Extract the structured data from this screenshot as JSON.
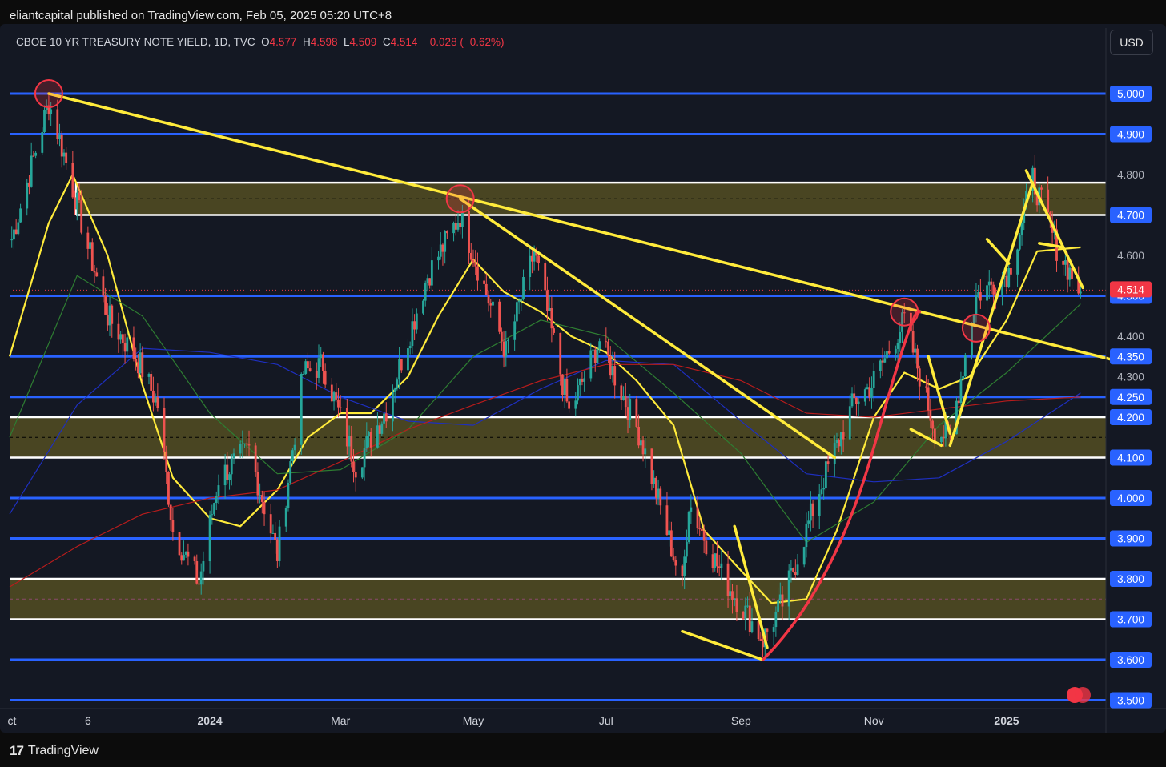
{
  "header": {
    "published_by": "eliantcapital published on TradingView.com, Feb 05, 2025 05:20 UTC+8"
  },
  "legend": {
    "symbol": "CBOE 10 YR TREASURY NOTE YIELD, 1D, TVC",
    "open_label": "O",
    "open": "4.577",
    "high_label": "H",
    "high": "4.598",
    "low_label": "L",
    "low": "4.509",
    "close_label": "C",
    "close": "4.514",
    "change": "−0.028 (−0.62%)"
  },
  "currency_button": "USD",
  "footer": {
    "brand": "TradingView",
    "brand_mark": "17"
  },
  "colors": {
    "background": "#141823",
    "level_blue": "#2962ff",
    "level_white": "#ffffff",
    "trendline": "#ffeb3b",
    "zone_fill": "#4f4a22",
    "up_candle": "#26a69a",
    "down_candle": "#ef5350",
    "last_price": "#f23645",
    "ma_fast": "#ffeb3b",
    "ma_mid": "#2e7d32",
    "ma_slow": "#1e2fbf",
    "ma_long": "#b71c1c",
    "arrow_red": "#f23645"
  },
  "chart_data": {
    "type": "candlestick",
    "title": "CBOE 10 YR TREASURY NOTE YIELD, 1D, TVC",
    "ylim": [
      3.47,
      5.13
    ],
    "x_axis_labels": [
      {
        "label": "ct",
        "date": "2023-10-01",
        "bold": false
      },
      {
        "label": "6",
        "date": "2023-11-06",
        "bold": false
      },
      {
        "label": "2024",
        "date": "2024-01-01",
        "bold": true
      },
      {
        "label": "Mar",
        "date": "2024-03-01",
        "bold": false
      },
      {
        "label": "May",
        "date": "2024-05-01",
        "bold": false
      },
      {
        "label": "Jul",
        "date": "2024-07-01",
        "bold": false
      },
      {
        "label": "Sep",
        "date": "2024-09-01",
        "bold": false
      },
      {
        "label": "Nov",
        "date": "2024-11-01",
        "bold": false
      },
      {
        "label": "2025",
        "date": "2025-01-01",
        "bold": true
      }
    ],
    "y_axis_labels": [
      "5.000",
      "4.900",
      "4.800",
      "4.700",
      "4.600",
      "4.500",
      "4.400",
      "4.350",
      "4.300",
      "4.250",
      "4.200",
      "4.100",
      "4.000",
      "3.900",
      "3.800",
      "3.700",
      "3.600",
      "3.500"
    ],
    "highlighted_price_labels": [
      "5.000",
      "4.900",
      "4.700",
      "4.500",
      "4.350",
      "4.250",
      "4.200",
      "4.100",
      "4.000",
      "3.900",
      "3.800",
      "3.700",
      "3.600",
      "3.500"
    ],
    "last_price": "4.514",
    "horizontal_levels": [
      {
        "price": 5.0,
        "color": "blue"
      },
      {
        "price": 4.9,
        "color": "blue"
      },
      {
        "price": 4.5,
        "color": "blue"
      },
      {
        "price": 4.35,
        "color": "blue"
      },
      {
        "price": 4.25,
        "color": "blue"
      },
      {
        "price": 4.0,
        "color": "blue"
      },
      {
        "price": 3.9,
        "color": "blue"
      },
      {
        "price": 3.6,
        "color": "blue"
      },
      {
        "price": 3.5,
        "color": "blue"
      }
    ],
    "zones": [
      {
        "from": 4.7,
        "to": 4.78
      },
      {
        "from": 4.1,
        "to": 4.2
      },
      {
        "from": 3.7,
        "to": 3.8
      }
    ],
    "trendlines": [
      {
        "from": [
          "2023-10-19",
          5.0
        ],
        "to": [
          "2025-02-20",
          4.34
        ]
      },
      {
        "from": [
          "2024-04-25",
          4.74
        ],
        "to": [
          "2024-10-14",
          4.1
        ]
      },
      {
        "from": [
          "2024-08-05",
          3.67
        ],
        "to": [
          "2024-09-11",
          3.6
        ]
      },
      {
        "from": [
          "2024-08-29",
          3.93
        ],
        "to": [
          "2024-09-13",
          3.63
        ]
      },
      {
        "from": [
          "2024-11-26",
          4.35
        ],
        "to": [
          "2024-12-06",
          4.16
        ]
      },
      {
        "from": [
          "2024-12-06",
          4.13
        ],
        "to": [
          "2025-01-13",
          4.78
        ]
      },
      {
        "from": [
          "2025-01-10",
          4.81
        ],
        "to": [
          "2025-02-05",
          4.52
        ]
      },
      {
        "from": [
          "2024-12-23",
          4.64
        ],
        "to": [
          "2025-01-02",
          4.58
        ]
      },
      {
        "from": [
          "2024-11-18",
          4.17
        ],
        "to": [
          "2024-12-02",
          4.13
        ]
      },
      {
        "from": [
          "2025-01-16",
          4.63
        ],
        "to": [
          "2025-01-27",
          4.62
        ]
      }
    ],
    "arrow": {
      "from": [
        "2024-09-11",
        3.6
      ],
      "to": [
        "2024-11-22",
        4.46
      ]
    },
    "circles": [
      {
        "date": "2023-10-19",
        "price": 5.0
      },
      {
        "date": "2024-04-25",
        "price": 4.74
      },
      {
        "date": "2024-11-15",
        "price": 4.46
      },
      {
        "date": "2024-12-18",
        "price": 4.42
      }
    ],
    "close_anchors": [
      [
        "2023-10-01",
        4.62
      ],
      [
        "2023-10-19",
        4.98
      ],
      [
        "2023-10-26",
        4.85
      ],
      [
        "2023-11-06",
        4.62
      ],
      [
        "2023-11-15",
        4.45
      ],
      [
        "2023-11-30",
        4.33
      ],
      [
        "2023-12-08",
        4.23
      ],
      [
        "2023-12-15",
        3.92
      ],
      [
        "2023-12-27",
        3.79
      ],
      [
        "2024-01-05",
        4.05
      ],
      [
        "2024-01-19",
        4.12
      ],
      [
        "2024-02-01",
        3.86
      ],
      [
        "2024-02-13",
        4.31
      ],
      [
        "2024-02-22",
        4.33
      ],
      [
        "2024-03-08",
        4.08
      ],
      [
        "2024-03-22",
        4.22
      ],
      [
        "2024-04-10",
        4.55
      ],
      [
        "2024-04-25",
        4.7
      ],
      [
        "2024-05-16",
        4.36
      ],
      [
        "2024-05-29",
        4.61
      ],
      [
        "2024-06-14",
        4.21
      ],
      [
        "2024-06-28",
        4.39
      ],
      [
        "2024-07-17",
        4.15
      ],
      [
        "2024-08-05",
        3.78
      ],
      [
        "2024-08-08",
        3.99
      ],
      [
        "2024-08-23",
        3.81
      ],
      [
        "2024-09-11",
        3.65
      ],
      [
        "2024-09-20",
        3.74
      ],
      [
        "2024-10-07",
        4.02
      ],
      [
        "2024-10-23",
        4.24
      ],
      [
        "2024-10-31",
        4.28
      ],
      [
        "2024-11-15",
        4.44
      ],
      [
        "2024-11-29",
        4.17
      ],
      [
        "2024-12-06",
        4.15
      ],
      [
        "2024-12-18",
        4.5
      ],
      [
        "2025-01-02",
        4.56
      ],
      [
        "2025-01-13",
        4.79
      ],
      [
        "2025-01-24",
        4.62
      ],
      [
        "2025-02-04",
        4.51
      ]
    ],
    "moving_averages": [
      {
        "color": "yellow",
        "points": [
          [
            "2023-10-01",
            4.35
          ],
          [
            "2023-10-19",
            4.68
          ],
          [
            "2023-10-30",
            4.8
          ],
          [
            "2023-11-15",
            4.6
          ],
          [
            "2023-12-01",
            4.28
          ],
          [
            "2023-12-15",
            4.05
          ],
          [
            "2024-01-01",
            3.95
          ],
          [
            "2024-01-15",
            3.93
          ],
          [
            "2024-02-01",
            4.02
          ],
          [
            "2024-02-15",
            4.15
          ],
          [
            "2024-03-01",
            4.21
          ],
          [
            "2024-03-15",
            4.21
          ],
          [
            "2024-04-01",
            4.3
          ],
          [
            "2024-04-15",
            4.45
          ],
          [
            "2024-05-01",
            4.59
          ],
          [
            "2024-05-15",
            4.51
          ],
          [
            "2024-06-01",
            4.46
          ],
          [
            "2024-06-15",
            4.4
          ],
          [
            "2024-07-01",
            4.36
          ],
          [
            "2024-07-15",
            4.29
          ],
          [
            "2024-08-01",
            4.18
          ],
          [
            "2024-08-15",
            3.92
          ],
          [
            "2024-09-01",
            3.82
          ],
          [
            "2024-09-15",
            3.74
          ],
          [
            "2024-10-01",
            3.75
          ],
          [
            "2024-10-15",
            3.92
          ],
          [
            "2024-11-01",
            4.2
          ],
          [
            "2024-11-15",
            4.31
          ],
          [
            "2024-12-01",
            4.27
          ],
          [
            "2024-12-15",
            4.3
          ],
          [
            "2025-01-01",
            4.44
          ],
          [
            "2025-01-15",
            4.61
          ],
          [
            "2025-02-04",
            4.62
          ]
        ]
      },
      {
        "color": "green",
        "points": [
          [
            "2023-10-01",
            4.15
          ],
          [
            "2023-11-01",
            4.55
          ],
          [
            "2023-12-01",
            4.45
          ],
          [
            "2024-01-01",
            4.21
          ],
          [
            "2024-02-01",
            4.06
          ],
          [
            "2024-03-01",
            4.07
          ],
          [
            "2024-04-01",
            4.17
          ],
          [
            "2024-05-01",
            4.35
          ],
          [
            "2024-06-01",
            4.44
          ],
          [
            "2024-07-01",
            4.4
          ],
          [
            "2024-08-01",
            4.26
          ],
          [
            "2024-09-01",
            4.11
          ],
          [
            "2024-10-01",
            3.89
          ],
          [
            "2024-11-01",
            3.99
          ],
          [
            "2024-12-01",
            4.18
          ],
          [
            "2025-01-01",
            4.31
          ],
          [
            "2025-02-04",
            4.48
          ]
        ]
      },
      {
        "color": "navy",
        "points": [
          [
            "2023-10-01",
            3.96
          ],
          [
            "2023-11-01",
            4.23
          ],
          [
            "2023-12-01",
            4.37
          ],
          [
            "2024-01-01",
            4.36
          ],
          [
            "2024-02-01",
            4.33
          ],
          [
            "2024-03-01",
            4.25
          ],
          [
            "2024-04-01",
            4.19
          ],
          [
            "2024-05-01",
            4.18
          ],
          [
            "2024-06-01",
            4.27
          ],
          [
            "2024-07-01",
            4.34
          ],
          [
            "2024-08-01",
            4.33
          ],
          [
            "2024-09-01",
            4.19
          ],
          [
            "2024-10-01",
            4.06
          ],
          [
            "2024-11-01",
            4.04
          ],
          [
            "2024-12-01",
            4.05
          ],
          [
            "2025-01-01",
            4.14
          ],
          [
            "2025-02-04",
            4.26
          ]
        ]
      },
      {
        "color": "red",
        "points": [
          [
            "2023-10-01",
            3.78
          ],
          [
            "2023-11-01",
            3.88
          ],
          [
            "2023-12-01",
            3.96
          ],
          [
            "2024-01-01",
            4.0
          ],
          [
            "2024-02-01",
            4.02
          ],
          [
            "2024-03-01",
            4.09
          ],
          [
            "2024-04-01",
            4.17
          ],
          [
            "2024-05-01",
            4.23
          ],
          [
            "2024-06-01",
            4.29
          ],
          [
            "2024-07-01",
            4.33
          ],
          [
            "2024-08-01",
            4.33
          ],
          [
            "2024-09-01",
            4.29
          ],
          [
            "2024-10-01",
            4.21
          ],
          [
            "2024-11-01",
            4.2
          ],
          [
            "2024-12-01",
            4.22
          ],
          [
            "2025-01-01",
            4.24
          ],
          [
            "2025-02-04",
            4.25
          ]
        ]
      }
    ]
  }
}
